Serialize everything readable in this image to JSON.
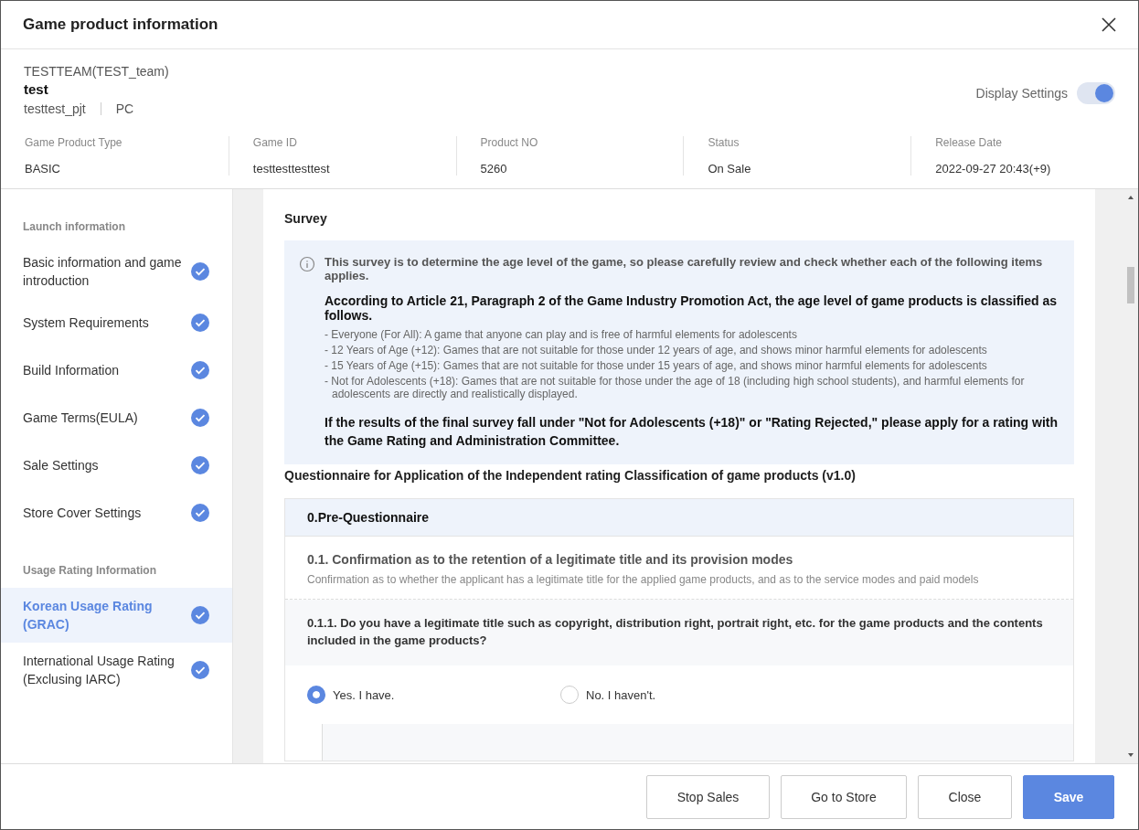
{
  "window": {
    "title": "Game product information"
  },
  "product": {
    "team": "TESTTEAM(TEST_team)",
    "name": "test",
    "project": "testtest_pjt",
    "platform": "PC"
  },
  "display_settings": {
    "label": "Display Settings",
    "on": true
  },
  "info": [
    {
      "label": "Game Product Type",
      "value": "BASIC"
    },
    {
      "label": "Game ID",
      "value": "testtesttesttest"
    },
    {
      "label": "Product NO",
      "value": "5260"
    },
    {
      "label": "Status",
      "value": "On Sale"
    },
    {
      "label": "Release Date",
      "value": "2022-09-27 20:43(+9)"
    }
  ],
  "sidebar": {
    "sections": [
      {
        "title": "Launch information",
        "items": [
          {
            "label": "Basic information and game introduction",
            "done": true,
            "selected": false
          },
          {
            "label": "System Requirements",
            "done": true,
            "selected": false
          },
          {
            "label": "Build Information",
            "done": true,
            "selected": false
          },
          {
            "label": "Game Terms(EULA)",
            "done": true,
            "selected": false
          },
          {
            "label": "Sale Settings",
            "done": true,
            "selected": false
          },
          {
            "label": "Store Cover Settings",
            "done": true,
            "selected": false
          }
        ]
      },
      {
        "title": "Usage Rating Information",
        "items": [
          {
            "label": "Korean Usage Rating (GRAC)",
            "done": true,
            "selected": true
          },
          {
            "label": "International Usage Rating (Exclusing IARC)",
            "done": true,
            "selected": false
          }
        ]
      }
    ]
  },
  "survey": {
    "title": "Survey",
    "notice": {
      "intro": "This survey is to determine the age level of the game, so please carefully review and check whether each of the following items applies.",
      "heading": "According to Article 21, Paragraph 2 of the Game Industry Promotion Act, the age level of game products is classified as follows.",
      "items": [
        "- Everyone (For All): A game that anyone can play and is free of harmful elements for adolescents",
        "- 12 Years of Age (+12): Games that are not suitable for those under 12 years of age, and shows minor harmful elements for adolescents",
        "- 15 Years of Age (+15): Games that are not suitable for those under 15 years of age, and shows minor harmful elements for adolescents",
        "- Not for Adolescents (+18): Games that are not suitable for those under the age of 18 (including high school students), and harmful elements for adolescents are directly and realistically displayed."
      ],
      "footer": "If the results of the final survey fall under \"Not for Adolescents (+18)\" or \"Rating Rejected,\" please apply for a rating with the Game Rating and Administration Committee."
    },
    "questionnaire_title": "Questionnaire for Application of the Independent rating Classification of game products (v1.0)",
    "section": "0.Pre-Questionnaire",
    "subsection": {
      "title": "0.1. Confirmation as to the retention of a legitimate title and its provision modes",
      "description": "Confirmation as to whether the applicant has a legitimate title for the applied game products, and as to the service modes and paid models"
    },
    "question": "0.1.1. Do you have a legitimate title such as copyright, distribution right, portrait right, etc. for the game products and the contents included in the game products?",
    "options": [
      {
        "label": "Yes. I have.",
        "selected": true
      },
      {
        "label": "No. I haven't.",
        "selected": false
      }
    ]
  },
  "buttons": [
    {
      "label": "Stop Sales",
      "kind": "secondary"
    },
    {
      "label": "Go to Store",
      "kind": "secondary"
    },
    {
      "label": "Close",
      "kind": "secondary"
    },
    {
      "label": "Save",
      "kind": "primary"
    }
  ]
}
